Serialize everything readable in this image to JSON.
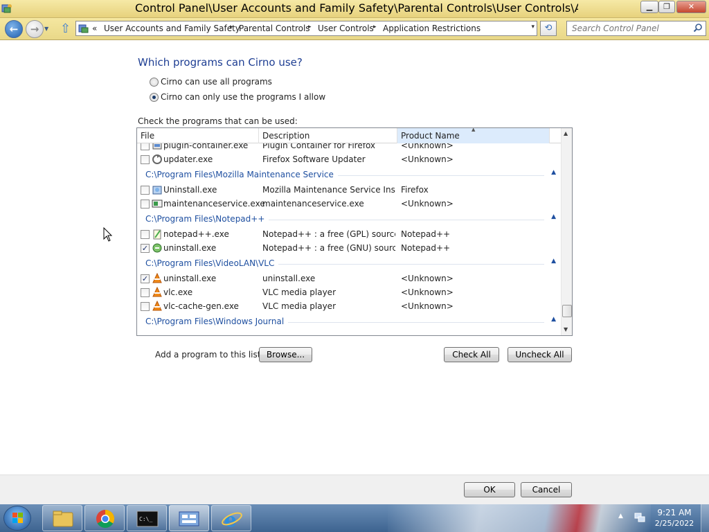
{
  "window": {
    "title": "Control Panel\\User Accounts and Family Safety\\Parental Controls\\User Controls\\Application Restr",
    "min_label": "▁",
    "max_label": "❐",
    "close_label": "✕"
  },
  "address": {
    "overflow": "«",
    "crumbs": [
      "User Accounts and Family Safety",
      "Parental Controls",
      "User Controls",
      "Application Restrictions"
    ],
    "separator": "▸",
    "dropdown": "▾",
    "refresh": "⟲"
  },
  "search": {
    "placeholder": "Search Control Panel"
  },
  "main": {
    "heading": "Which programs can Cirno use?",
    "option_all": "Cirno can use all programs",
    "option_allowed": "Cirno can only use the programs I allow",
    "selected_option": "allowed",
    "check_label": "Check the programs that can be used:"
  },
  "list": {
    "columns": {
      "file": "File",
      "description": "Description",
      "product": "Product Name"
    },
    "sort_indicator": "▲",
    "sorted_column": "Product Name",
    "items": [
      {
        "type": "row",
        "checked": false,
        "icon": "plugin-icon",
        "file": "plugin-container.exe",
        "description": "Plugin Container for Firefox",
        "product": "<Unknown>"
      },
      {
        "type": "row",
        "checked": false,
        "icon": "updater-icon",
        "file": "updater.exe",
        "description": "Firefox Software Updater",
        "product": "<Unknown>"
      },
      {
        "type": "group",
        "path": "C:\\Program Files\\Mozilla Maintenance Service"
      },
      {
        "type": "row",
        "checked": false,
        "icon": "installer-icon",
        "file": "Uninstall.exe",
        "description": "Mozilla Maintenance Service Insta...",
        "product": "Firefox"
      },
      {
        "type": "row",
        "checked": false,
        "icon": "service-icon",
        "file": "maintenanceservice.exe",
        "description": "maintenanceservice.exe",
        "product": "<Unknown>"
      },
      {
        "type": "group",
        "path": "C:\\Program Files\\Notepad++"
      },
      {
        "type": "row",
        "checked": false,
        "icon": "notepad-icon",
        "file": "notepad++.exe",
        "description": "Notepad++ : a free (GPL) source c...",
        "product": "Notepad++"
      },
      {
        "type": "row",
        "checked": true,
        "icon": "notepad-uninstall-icon",
        "file": "uninstall.exe",
        "description": "Notepad++ : a free (GNU) source ...",
        "product": "Notepad++"
      },
      {
        "type": "group",
        "path": "C:\\Program Files\\VideoLAN\\VLC"
      },
      {
        "type": "row",
        "checked": true,
        "icon": "vlc-icon",
        "file": "uninstall.exe",
        "description": "uninstall.exe",
        "product": "<Unknown>"
      },
      {
        "type": "row",
        "checked": false,
        "icon": "vlc-icon",
        "file": "vlc.exe",
        "description": "VLC media player",
        "product": "<Unknown>"
      },
      {
        "type": "row",
        "checked": false,
        "icon": "vlc-icon",
        "file": "vlc-cache-gen.exe",
        "description": "VLC media player",
        "product": "<Unknown>"
      },
      {
        "type": "group",
        "path": "C:\\Program Files\\Windows Journal"
      }
    ],
    "group_caret": "▲",
    "check_mark": "✓",
    "scroll_up": "▲",
    "scroll_down": "▼"
  },
  "actions": {
    "add_label": "Add a program to this list:",
    "browse": "Browse...",
    "check_all": "Check All",
    "uncheck_all": "Uncheck All"
  },
  "footer": {
    "ok": "OK",
    "cancel": "Cancel"
  },
  "taskbar": {
    "apps": [
      "explorer-icon",
      "chrome-icon",
      "cmd-icon",
      "control-panel-icon",
      "ie-icon"
    ],
    "tray_arrow": "▲",
    "time": "9:21 AM",
    "date": "2/25/2022"
  },
  "colors": {
    "accent_text": "#1e3e93",
    "group_text": "#1e4fa0",
    "titlebar": "#e7d27d",
    "taskbar": "#3d6390"
  }
}
